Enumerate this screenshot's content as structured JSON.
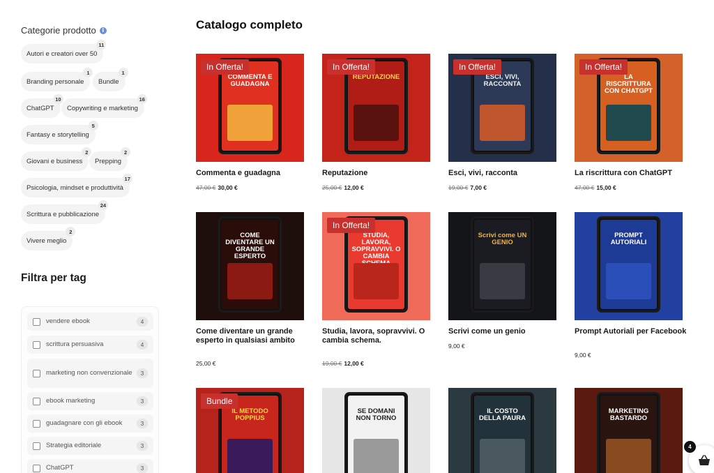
{
  "sidebar": {
    "categories_title": "Categorie prodotto",
    "categories": [
      {
        "label": "Autori e creatori over 50",
        "count": "11"
      },
      {
        "label": "Branding personale",
        "count": "1"
      },
      {
        "label": "Bundle",
        "count": "1"
      },
      {
        "label": "ChatGPT",
        "count": "10"
      },
      {
        "label": "Copywriting e marketing",
        "count": "16"
      },
      {
        "label": "Fantasy e storytelling",
        "count": "5"
      },
      {
        "label": "Giovani e business",
        "count": "2"
      },
      {
        "label": "Prepping",
        "count": "2"
      },
      {
        "label": "Psicologia, mindset e produttività",
        "count": "17"
      },
      {
        "label": "Scrittura e pubblicazione",
        "count": "24"
      },
      {
        "label": "Vivere meglio",
        "count": "2"
      }
    ],
    "tags_title": "Filtra per tag",
    "tags": [
      {
        "label": "vendere ebook",
        "count": "4"
      },
      {
        "label": "scrittura persuasiva",
        "count": "4"
      },
      {
        "label": "marketing non convenzionale",
        "count": "3"
      },
      {
        "label": "ebook marketing",
        "count": "3"
      },
      {
        "label": "guadagnare con gli ebook",
        "count": "3"
      },
      {
        "label": "Strategia editoriale",
        "count": "3"
      },
      {
        "label": "ChatGPT",
        "count": "3"
      }
    ]
  },
  "main": {
    "title": "Catalogo completo",
    "products": [
      {
        "name": "Commenta e guadagna",
        "badge": "In Offerta!",
        "old_price": "47,00 €",
        "price": "30,00 €",
        "cover_title": "COMMENTA E GUADAGNA",
        "bg": "#d8261c",
        "screen_bg": "#e0301f",
        "screen_fg": "#ffffff",
        "art": "#f2a23a"
      },
      {
        "name": "Reputazione",
        "badge": "In Offerta!",
        "old_price": "25,00 €",
        "price": "12,00 €",
        "cover_title": "REPUTAZIONE",
        "bg": "#c4231a",
        "screen_bg": "#b01d16",
        "screen_fg": "#ffd24a",
        "art": "#5a120e"
      },
      {
        "name": "Esci, vivi, racconta",
        "badge": "In Offerta!",
        "old_price": "19,00 €",
        "price": "7,00 €",
        "cover_title": "ESCI, VIVI, RACCONTA",
        "bg": "#24304a",
        "screen_bg": "#2c3a58",
        "screen_fg": "#f0f0f0",
        "art": "#c0562e"
      },
      {
        "name": "La riscrittura con ChatGPT",
        "badge": "In Offerta!",
        "old_price": "47,00 €",
        "price": "15,00 €",
        "cover_title": "LA RISCRITTURA CON CHATGPT",
        "bg": "#d4602a",
        "screen_bg": "#d65f22",
        "screen_fg": "#ffffff",
        "art": "#214a4e"
      },
      {
        "name": "Come diventare un grande esperto in qualsiasi ambito",
        "badge": "",
        "old_price": "",
        "price": "25,00 €",
        "cover_title": "COME DIVENTARE UN GRANDE ESPERTO",
        "bg": "#1e0f0c",
        "screen_bg": "#2a0c09",
        "screen_fg": "#ffffff",
        "art": "#8a1a12"
      },
      {
        "name": "Studia, lavora, sopravvivi. O cambia schema.",
        "badge": "In Offerta!",
        "old_price": "19,00 €",
        "price": "12,00 €",
        "cover_title": "STUDIA, LAVORA, SOPRAVVIVI. O CAMBIA SCHEMA",
        "bg": "#f06a5a",
        "screen_bg": "#e83a2e",
        "screen_fg": "#ffffff",
        "art": "#b8261c"
      },
      {
        "name": "Scrivi come un genio",
        "badge": "",
        "old_price": "",
        "price": "9,00 €",
        "cover_title": "Scrivi come UN GENIO",
        "bg": "#121418",
        "screen_bg": "#1a1c22",
        "screen_fg": "#f0b43a",
        "art": "#3a3a42"
      },
      {
        "name": "Prompt Autoriali per Facebook",
        "badge": "",
        "old_price": "",
        "price": "9,00 €",
        "cover_title": "PROMPT AUTORIALI",
        "bg": "#2240a0",
        "screen_bg": "#1d3a94",
        "screen_fg": "#ffffff",
        "art": "#2a4fb8"
      },
      {
        "name": "",
        "badge": "Bundle",
        "old_price": "",
        "price": "",
        "cover_title": "IL METODO POPPIUS",
        "bg": "#b4231c",
        "screen_bg": "#c7261c",
        "screen_fg": "#ffd24a",
        "art": "#3a1a5a"
      },
      {
        "name": "",
        "badge": "",
        "old_price": "",
        "price": "",
        "cover_title": "SE DOMANI NON TORNO",
        "bg": "#e6e6e6",
        "screen_bg": "#f2f2f2",
        "screen_fg": "#222222",
        "art": "#9a9a9a"
      },
      {
        "name": "",
        "badge": "",
        "old_price": "",
        "price": "",
        "cover_title": "IL COSTO DELLA PAURA",
        "bg": "#2a3a40",
        "screen_bg": "#22323a",
        "screen_fg": "#ffffff",
        "art": "#4a5a60"
      },
      {
        "name": "",
        "badge": "",
        "old_price": "",
        "price": "",
        "cover_title": "MARKETING BASTARDO",
        "bg": "#5a1a10",
        "screen_bg": "#2a1410",
        "screen_fg": "#ffffff",
        "art": "#8a4a20"
      }
    ]
  },
  "cart": {
    "count": "4"
  }
}
